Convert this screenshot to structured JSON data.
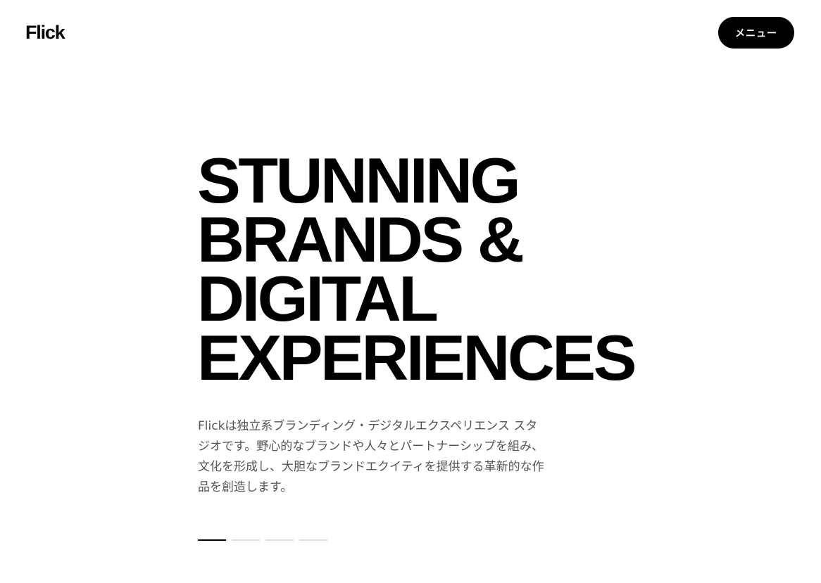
{
  "header": {
    "logo": "Flick",
    "menu_label": "メニュー"
  },
  "hero": {
    "headline_lines": [
      "STUNNING",
      "BRANDS &",
      "DIGITAL",
      "EXPERIENCES"
    ],
    "description": "Flickは独立系ブランディング・デジタルエクスペリエンス スタジオです。野心的なブランドや人々とパートナーシップを組み、 文化を形成し、大胆なブランドエクイティを提供する革新的な作品を創造します。"
  },
  "carousel": {
    "slide_count": 4,
    "active_index": 0
  },
  "colors": {
    "background": "#ffffff",
    "text": "#000000",
    "body_text": "#555555",
    "indicator_active": "#000000",
    "indicator_inactive": "#dddddd"
  }
}
